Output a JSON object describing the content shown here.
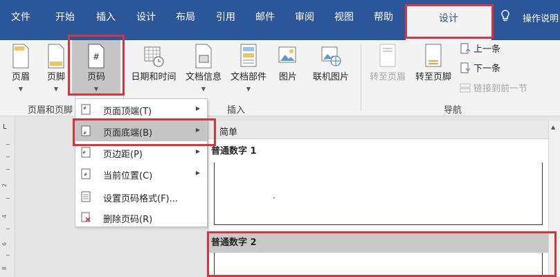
{
  "tabs": [
    "文件",
    "开始",
    "插入",
    "设计",
    "布局",
    "引用",
    "邮件",
    "审阅",
    "视图",
    "帮助"
  ],
  "active_tab": "设计",
  "tell_me": "操作说明",
  "ribbon": {
    "header_footer": {
      "group_label": "页眉和页脚",
      "buttons": [
        "页眉",
        "页脚",
        "页码"
      ]
    },
    "insert": {
      "group_label": "插入",
      "buttons": [
        "日期和时间",
        "文档信息",
        "文档部件",
        "图片",
        "联机图片"
      ]
    },
    "navigation": {
      "group_label": "导航",
      "buttons": [
        "转至页眉",
        "转至页脚"
      ],
      "small": [
        "上一条",
        "下一条",
        "链接到前一节"
      ]
    }
  },
  "ruler": {
    "corner": "L",
    "numbers": [
      "2",
      "4",
      "6",
      "8"
    ]
  },
  "menu": {
    "items": [
      {
        "label": "页面顶端(T)",
        "submenu": true
      },
      {
        "label": "页面底端(B)",
        "submenu": true
      },
      {
        "label": "页边距(P)",
        "submenu": true
      },
      {
        "label": "当前位置(C)",
        "submenu": true
      },
      {
        "label": "设置页码格式(F)...",
        "submenu": false
      },
      {
        "label": "删除页码(R)",
        "submenu": false
      }
    ]
  },
  "gallery": {
    "header": "简单",
    "sections": [
      "普通数字 1",
      "普通数字 2"
    ]
  },
  "colors": {
    "ribbon_blue": "#2b579a",
    "highlight_red": "#d9343a"
  }
}
